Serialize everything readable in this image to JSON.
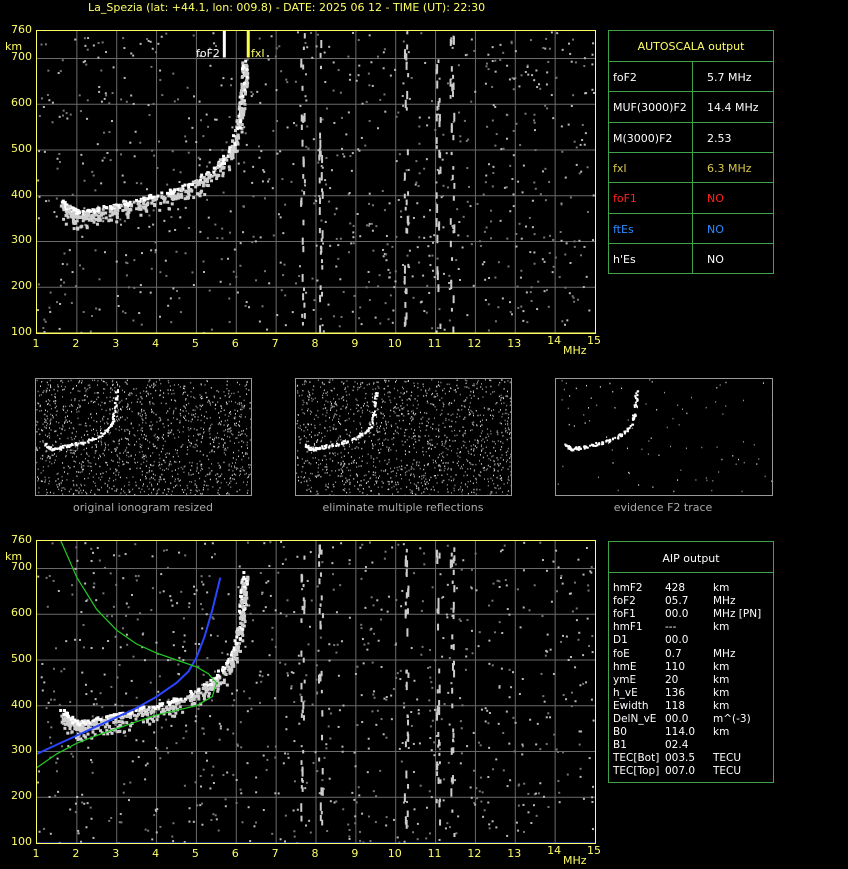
{
  "title": "La_Spezia (lat: +44.1, lon: 009.8) - DATE: 2025 06 12 - TIME (UT): 22:30",
  "axes": {
    "y_unit": "km",
    "x_unit": "MHz",
    "y_ticks": [
      "760",
      "700",
      "600",
      "500",
      "400",
      "300",
      "200",
      "100"
    ],
    "x_ticks": [
      "1",
      "2",
      "3",
      "4",
      "5",
      "6",
      "7",
      "8",
      "9",
      "10",
      "11",
      "12",
      "13",
      "14",
      "15"
    ]
  },
  "markers": {
    "foF2_label": "foF2",
    "fxI_label": "fxI"
  },
  "autoscala": {
    "title": "AUTOSCALA output",
    "rows": [
      {
        "key": "foF2",
        "value": "5.7 MHz",
        "kcolor": "#ffffff",
        "vcolor": "#ffffff"
      },
      {
        "key": "MUF(3000)F2",
        "value": "14.4 MHz",
        "kcolor": "#ffffff",
        "vcolor": "#ffffff"
      },
      {
        "key": "M(3000)F2",
        "value": "2.53",
        "kcolor": "#ffffff",
        "vcolor": "#ffffff"
      },
      {
        "key": "fxI",
        "value": "6.3 MHz",
        "kcolor": "#d8c84a",
        "vcolor": "#d8c84a"
      },
      {
        "key": "foF1",
        "value": "NO",
        "kcolor": "#ff2020",
        "vcolor": "#ff2020"
      },
      {
        "key": "ftEs",
        "value": "NO",
        "kcolor": "#2a8cff",
        "vcolor": "#2a8cff"
      },
      {
        "key": "h'Es",
        "value": "NO",
        "kcolor": "#ffffff",
        "vcolor": "#ffffff"
      }
    ]
  },
  "panels": {
    "captions": [
      "original ionogram resized",
      "eliminate multiple reflections",
      "evidence F2 trace"
    ]
  },
  "aip": {
    "title": "AIP output",
    "rows": [
      {
        "k": "hmF2",
        "v": "428",
        "u": "km"
      },
      {
        "k": "foF2",
        "v": "05.7",
        "u": "MHz"
      },
      {
        "k": "foF1",
        "v": "00.0",
        "u": "MHz   [PN]"
      },
      {
        "k": "hmF1",
        "v": "---",
        "u": "km"
      },
      {
        "k": "D1",
        "v": "00.0",
        "u": ""
      },
      {
        "k": "foE",
        "v": "0.7",
        "u": "MHz"
      },
      {
        "k": "hmE",
        "v": "110",
        "u": "km"
      },
      {
        "k": "ymE",
        "v": "20",
        "u": "km"
      },
      {
        "k": "h_vE",
        "v": "136",
        "u": "km"
      },
      {
        "k": "Ewidth",
        "v": "118",
        "u": "km"
      },
      {
        "k": "DelN_vE",
        "v": "00.0",
        "u": "m^(-3)"
      },
      {
        "k": "B0",
        "v": "114.0",
        "u": "km"
      },
      {
        "k": "B1",
        "v": "02.4",
        "u": ""
      },
      {
        "k": "TEC[Bot]",
        "v": "003.5",
        "u": "TECU"
      },
      {
        "k": "TEC[Top]",
        "v": "007.0",
        "u": "TECU"
      }
    ]
  },
  "chart_data": [
    {
      "type": "scatter",
      "x_range": [
        1,
        15
      ],
      "y_range": [
        100,
        760
      ],
      "grid": true,
      "series": [
        {
          "x": [
            1.6,
            1.8,
            2.0,
            2.3,
            2.6,
            3.0,
            3.5,
            4.0,
            4.5,
            5.0,
            5.4,
            5.8,
            6.0,
            6.1,
            6.15,
            6.2
          ],
          "values": [
            390,
            375,
            365,
            368,
            375,
            382,
            392,
            402,
            415,
            435,
            460,
            495,
            540,
            600,
            650,
            700
          ]
        }
      ],
      "markers_x": [
        5.7,
        6.3
      ]
    },
    {
      "type": "line",
      "x_range": [
        1,
        15
      ],
      "y_range": [
        100,
        760
      ],
      "grid": true,
      "series": [
        {
          "color": "#2a45ff",
          "x": [
            1.0,
            1.5,
            2.0,
            2.5,
            3.0,
            3.5,
            4.0,
            4.5,
            4.8,
            5.0,
            5.2,
            5.4,
            5.6
          ],
          "values": [
            295,
            315,
            335,
            355,
            375,
            395,
            420,
            450,
            475,
            505,
            550,
            610,
            680
          ]
        },
        {
          "color": "#22cc22",
          "x": [
            1.6,
            2.0,
            2.5,
            3.0,
            3.5,
            4.0,
            4.5,
            5.0,
            5.3,
            5.5,
            5.4,
            5.0,
            4.5,
            4.0,
            3.5,
            3.0,
            2.5,
            2.0,
            1.5,
            1.0
          ],
          "values": [
            760,
            680,
            610,
            565,
            535,
            515,
            500,
            485,
            470,
            450,
            420,
            400,
            390,
            380,
            365,
            350,
            335,
            318,
            295,
            265
          ]
        },
        {
          "color": "#ffffff",
          "x": [
            1.6,
            1.8,
            2.0,
            2.3,
            2.6,
            3.0,
            3.5,
            4.0,
            4.5,
            5.0,
            5.4,
            5.8,
            6.0,
            6.1,
            6.15,
            6.2
          ],
          "values": [
            390,
            375,
            365,
            368,
            375,
            382,
            392,
            402,
            415,
            435,
            460,
            495,
            540,
            600,
            650,
            700
          ]
        }
      ]
    }
  ]
}
